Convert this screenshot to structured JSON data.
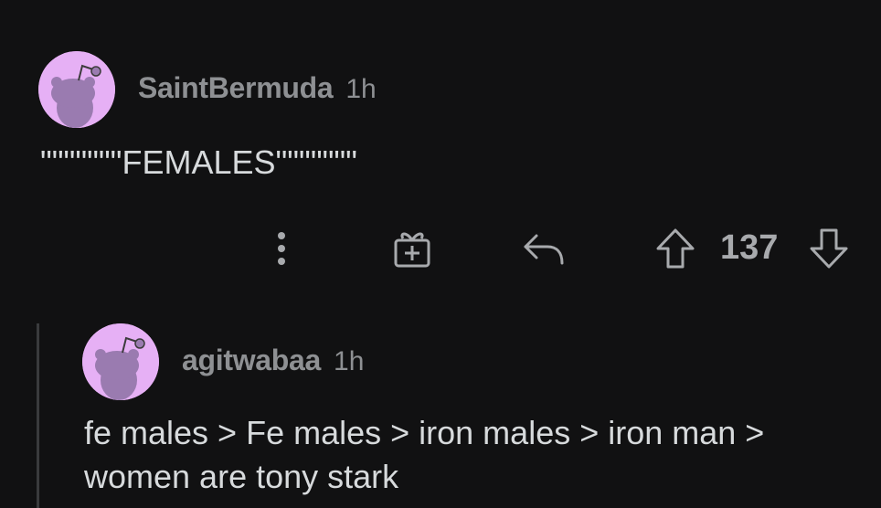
{
  "comments": [
    {
      "username": "SaintBermuda",
      "timestamp": "1h",
      "body_lines": [
        "\"\"\"\"\"\"\"FEMALES\"\"\"\"\"\"\""
      ],
      "avatar_icon": "snoo-avatar-icon"
    },
    {
      "username": "agitwabaa",
      "timestamp": "1h",
      "body_lines": [
        "fe males > Fe males > iron males > iron man >",
        "women are tony stark"
      ],
      "avatar_icon": "snoo-avatar-icon"
    }
  ],
  "actions": {
    "more_icon": "more-vertical-icon",
    "award_icon": "gift-award-icon",
    "reply_icon": "reply-arrow-icon",
    "upvote_icon": "upvote-arrow-icon",
    "downvote_icon": "downvote-arrow-icon",
    "vote_count": "137"
  },
  "colors": {
    "background": "#111112",
    "username": "#8e9093",
    "body_text": "#d7dadc",
    "avatar_bg": "#e6b0f5",
    "avatar_snoo": "#9a7bb0",
    "icon": "#a8aaad",
    "thread_line": "#3a3b3d"
  }
}
